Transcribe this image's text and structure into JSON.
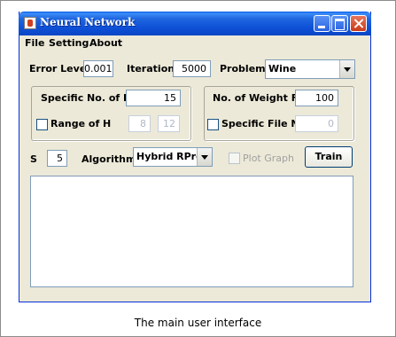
{
  "window": {
    "title": "Neural Network"
  },
  "menu": [
    "File",
    "Setting",
    "About"
  ],
  "row1": {
    "error_level_label": "Error Level",
    "error_level_value": "0.001",
    "iteration_label": "Iteration",
    "iteration_value": "5000",
    "problem_label": "Problem",
    "problem_value": "Wine"
  },
  "left_group": {
    "specific_h_label": "Specific No. of H",
    "specific_h_value": "15",
    "range_h_label": "Range of H",
    "range_h_from": "8",
    "range_h_to": "12"
  },
  "right_group": {
    "weight_file_label": "No. of Weight File",
    "weight_file_value": "100",
    "specific_file_label": "Specific File No.",
    "specific_file_value": "0"
  },
  "row3": {
    "s_label": "S",
    "s_value": "5",
    "algorithm_label": "Algorithm",
    "algorithm_value": "Hybrid RProp",
    "plot_graph_label": "Plot Graph",
    "train_label": "Train"
  },
  "caption": "The main user interface",
  "icons": {
    "app": "java-cup-icon",
    "minimize": "minimize-icon",
    "maximize": "maximize-icon",
    "close": "close-icon",
    "dropdown": "chevron-down-icon"
  },
  "colors": {
    "titlebar": "#0a46c4",
    "window_bg": "#ece9d8",
    "close_button": "#c93a1a"
  }
}
